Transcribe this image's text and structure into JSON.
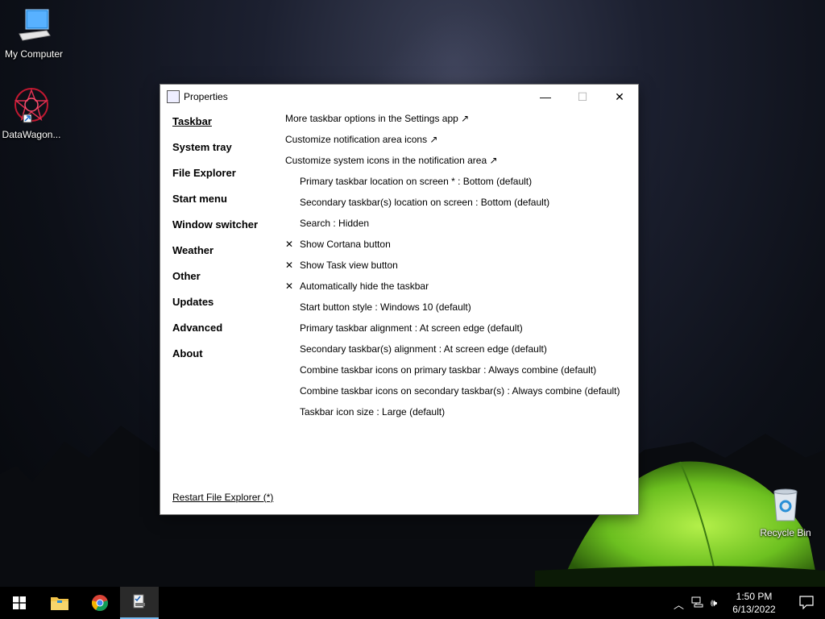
{
  "desktop": {
    "icons": [
      {
        "label": "My Computer",
        "icon": "computer-icon"
      },
      {
        "label": "DataWagon...",
        "icon": "datawagon-icon"
      },
      {
        "label": "Recycle Bin",
        "icon": "recycle-bin-icon"
      }
    ]
  },
  "window": {
    "title": "Properties",
    "controls": {
      "minimize": "—",
      "maximize": "☐",
      "close": "✕"
    },
    "sidebar": {
      "items": [
        {
          "label": "Taskbar",
          "active": true
        },
        {
          "label": "System tray"
        },
        {
          "label": "File Explorer"
        },
        {
          "label": "Start menu"
        },
        {
          "label": "Window switcher"
        },
        {
          "label": "Weather"
        },
        {
          "label": "Other"
        },
        {
          "label": "Updates"
        },
        {
          "label": "Advanced"
        },
        {
          "label": "About"
        }
      ]
    },
    "settings": [
      {
        "label": "More taskbar options in the Settings app ↗"
      },
      {
        "label": "Customize notification area icons ↗"
      },
      {
        "label": "Customize system icons in the notification area ↗"
      },
      {
        "label": "Primary taskbar location on screen * : Bottom (default)"
      },
      {
        "label": "Secondary taskbar(s) location on screen : Bottom (default)"
      },
      {
        "label": "Search : Hidden"
      },
      {
        "label": "Show Cortana button",
        "check": "✕"
      },
      {
        "label": "Show Task view button",
        "check": "✕"
      },
      {
        "label": "Automatically hide the taskbar",
        "check": "✕"
      },
      {
        "label": "Start button style : Windows 10 (default)"
      },
      {
        "label": "Primary taskbar alignment : At screen edge (default)"
      },
      {
        "label": "Secondary taskbar(s) alignment : At screen edge (default)"
      },
      {
        "label": "Combine taskbar icons on primary taskbar : Always combine (default)"
      },
      {
        "label": "Combine taskbar icons on secondary taskbar(s) : Always combine (default)"
      },
      {
        "label": "Taskbar icon size : Large (default)"
      }
    ],
    "footer_link": "Restart File Explorer (*)"
  },
  "taskbar": {
    "apps": [
      "windows-start-icon",
      "file-explorer-icon",
      "chrome-icon",
      "properties-app-icon"
    ],
    "time": "1:50 PM",
    "date": "6/13/2022",
    "tray_icons": [
      "chevron-up-icon",
      "network-icon",
      "volume-icon",
      "notifications-icon"
    ]
  },
  "colors": {
    "accent": "#76b9ed",
    "tent": "#7ccf2a",
    "window_bg": "#ffffff"
  }
}
